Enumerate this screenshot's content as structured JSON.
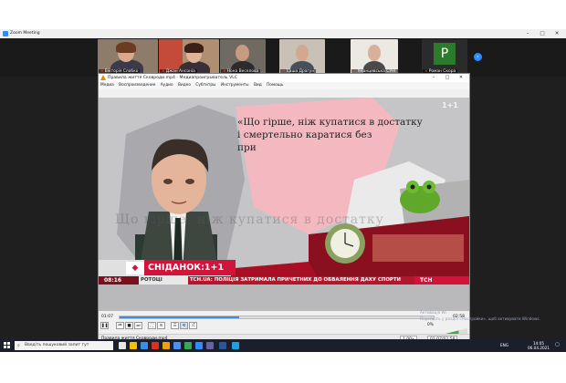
{
  "zoom": {
    "title": "Zoom Meeting",
    "participants": [
      {
        "name": "Вікторія Слобко",
        "muted": true
      },
      {
        "name": "Джан Ансоніа",
        "muted": true
      },
      {
        "name": "Нона Веселова",
        "muted": true
      },
      {
        "name": "Саша Драгун",
        "muted": true
      },
      {
        "name": "Уманцевська СУНІ",
        "muted": true
      },
      {
        "name": "Роман Скора",
        "muted": true,
        "avatar_letter": "P"
      }
    ]
  },
  "vlc": {
    "title": "Правила життя Сковроди.mp4 - Медиапроигрыватель VLC",
    "menu": [
      "Медиа",
      "Воспроизведение",
      "Аудио",
      "Видео",
      "Субтитры",
      "Инструменты",
      "Вид",
      "Помощь"
    ],
    "video": {
      "quote": [
        "«Що гірше, ніж купатися в достатку",
        "і смертельно каратися без",
        "при"
      ],
      "watermark": "Що гірше, ніж купатися в достатку",
      "channel_logo": "1+1",
      "show_name": "СНІДАНОК",
      "show_channel": "1+1",
      "clock": "08:16",
      "ticker_left": "РОТОЦІ",
      "ticker": "ТСН.UA: ПОЛІЦІЯ ЗАТРИМАЛА ПРИЧЕТНИХ ДО ОБВАЛЕННЯ ДАХУ СПОРТИ",
      "ticker_right": "ТСН"
    },
    "time_elapsed": "01:07",
    "time_total": "02:58",
    "progress": 0.38,
    "volume": 0.7,
    "volume_label": "0%",
    "status_file": "Правила життя Сковроди.mp4",
    "speed": "1.00x",
    "status_time": "01:07/02:58"
  },
  "activate_windows": {
    "line1": "Активація Wi",
    "line2": "Перейдіть у розділ «Настройки», щоб активувати Windows."
  },
  "taskbar": {
    "search_placeholder": "Введіть пошуковий запит тут",
    "lang": "ENG",
    "time": "14:05",
    "date": "06.04.2021"
  }
}
